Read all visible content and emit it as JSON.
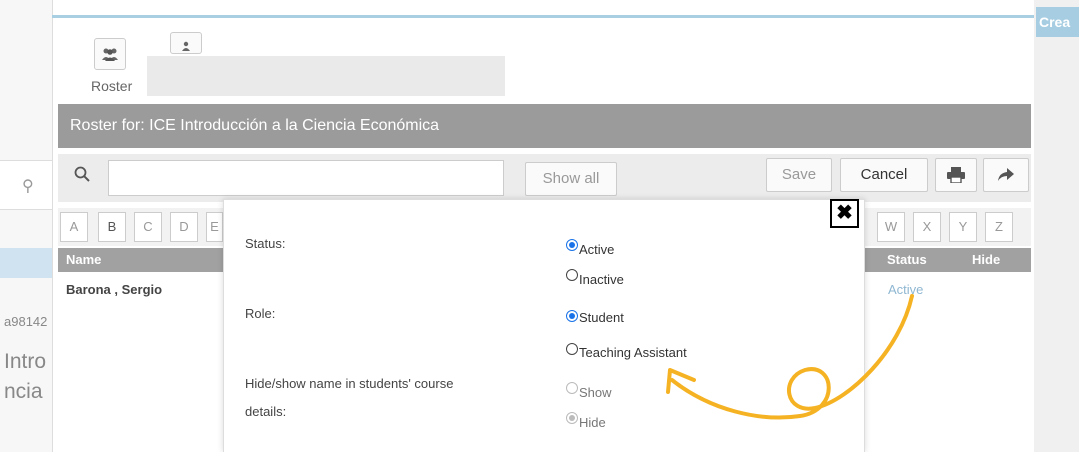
{
  "left_panel": {
    "search_icon": "search-icon",
    "id_text": "a98142",
    "title_line1": "Intro",
    "title_line2": "ncia"
  },
  "header": {
    "create_label": "Crea",
    "roster_label": "Roster"
  },
  "roster_bar": {
    "title": "Roster for: ICE Introducción a la Ciencia Económica"
  },
  "toolbar": {
    "search_placeholder": "",
    "show_all_label": "Show all",
    "save_label": "Save",
    "cancel_label": "Cancel",
    "print_icon": "printer-icon",
    "export_icon": "share-arrow-icon"
  },
  "letters_left": [
    "A",
    "B",
    "C",
    "D",
    "E"
  ],
  "letters_right": [
    "W",
    "X",
    "Y",
    "Z"
  ],
  "table": {
    "columns": {
      "name": "Name",
      "status": "Status",
      "hide": "Hide"
    },
    "rows": [
      {
        "name": "Barona , Sergio",
        "status": "Active"
      }
    ]
  },
  "modal": {
    "close_icon": "close-icon",
    "status": {
      "label": "Status:",
      "options": [
        {
          "label": "Active",
          "selected": true
        },
        {
          "label": "Inactive",
          "selected": false
        }
      ]
    },
    "role": {
      "label": "Role:",
      "options": [
        {
          "label": "Student",
          "selected": true
        },
        {
          "label": "Teaching Assistant",
          "selected": false
        }
      ]
    },
    "visibility": {
      "label_line1": "Hide/show name in students' course",
      "label_line2": "details:",
      "options": [
        {
          "label": "Show",
          "selected": false
        },
        {
          "label": "Hide",
          "selected": true
        }
      ]
    }
  },
  "colors": {
    "accent_blue": "#a9cfe3",
    "bar_gray": "#9b9b9b",
    "annotation_orange": "#f5b324"
  }
}
